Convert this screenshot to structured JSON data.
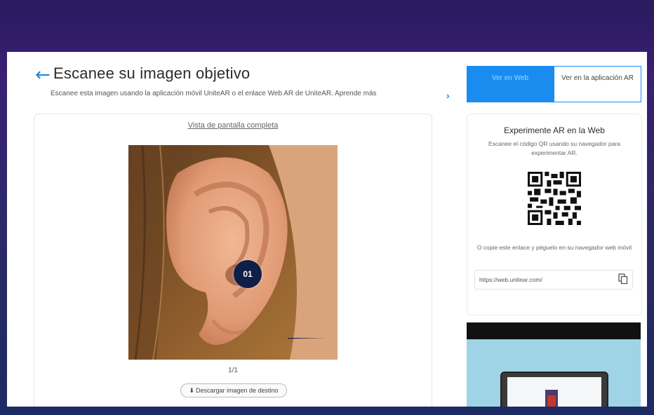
{
  "header": {
    "title": "Escanee su imagen objetivo",
    "subtitle": "Escanee esta imagen usando la aplicación móvil UniteAR o el enlace Web AR de UniteAR. Aprende más"
  },
  "target": {
    "fullscreen_link": "Vista de pantalla completa",
    "marker_label": "01",
    "counter": "1/1",
    "download_label": "Descargar imagen de destino"
  },
  "tabs": {
    "web": "Ver en Web",
    "app": "Ver en la aplicación AR"
  },
  "ar_web": {
    "title": "Experimente AR en la Web",
    "description": "Escanee el código QR usando su navegador para experimentar AR.",
    "copy_instruction": "O copie este enlace y péguelo en su navegador web móvil",
    "url": "https://web.unitear.com/"
  },
  "colors": {
    "accent": "#1a8cf0",
    "marker": "#0f1f4a"
  }
}
